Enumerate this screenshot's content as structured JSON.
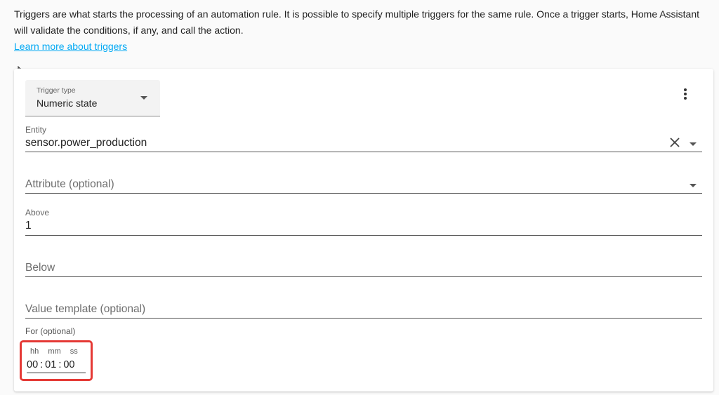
{
  "intro": {
    "text_line1": "Triggers are what starts the processing of an automation rule. It is possible to specify multiple triggers for the same rule. Once a trigger starts, Home Assistant will validate the conditions, if any, and call the action.",
    "link": "Learn more about triggers"
  },
  "trigger": {
    "type_label": "Trigger type",
    "type_value": "Numeric state"
  },
  "fields": {
    "entity": {
      "label": "Entity",
      "value": "sensor.power_production"
    },
    "attribute": {
      "placeholder": "Attribute (optional)"
    },
    "above": {
      "label": "Above",
      "value": "1"
    },
    "below": {
      "placeholder": "Below"
    },
    "value_template": {
      "placeholder": "Value template (optional)"
    }
  },
  "duration": {
    "label": "For (optional)",
    "headers": [
      "hh",
      "mm",
      "ss"
    ],
    "hours": "00",
    "minutes": "01",
    "seconds": "00",
    "separator": ":"
  },
  "colors": {
    "link": "#03a9f4",
    "highlight": "#e53935"
  }
}
